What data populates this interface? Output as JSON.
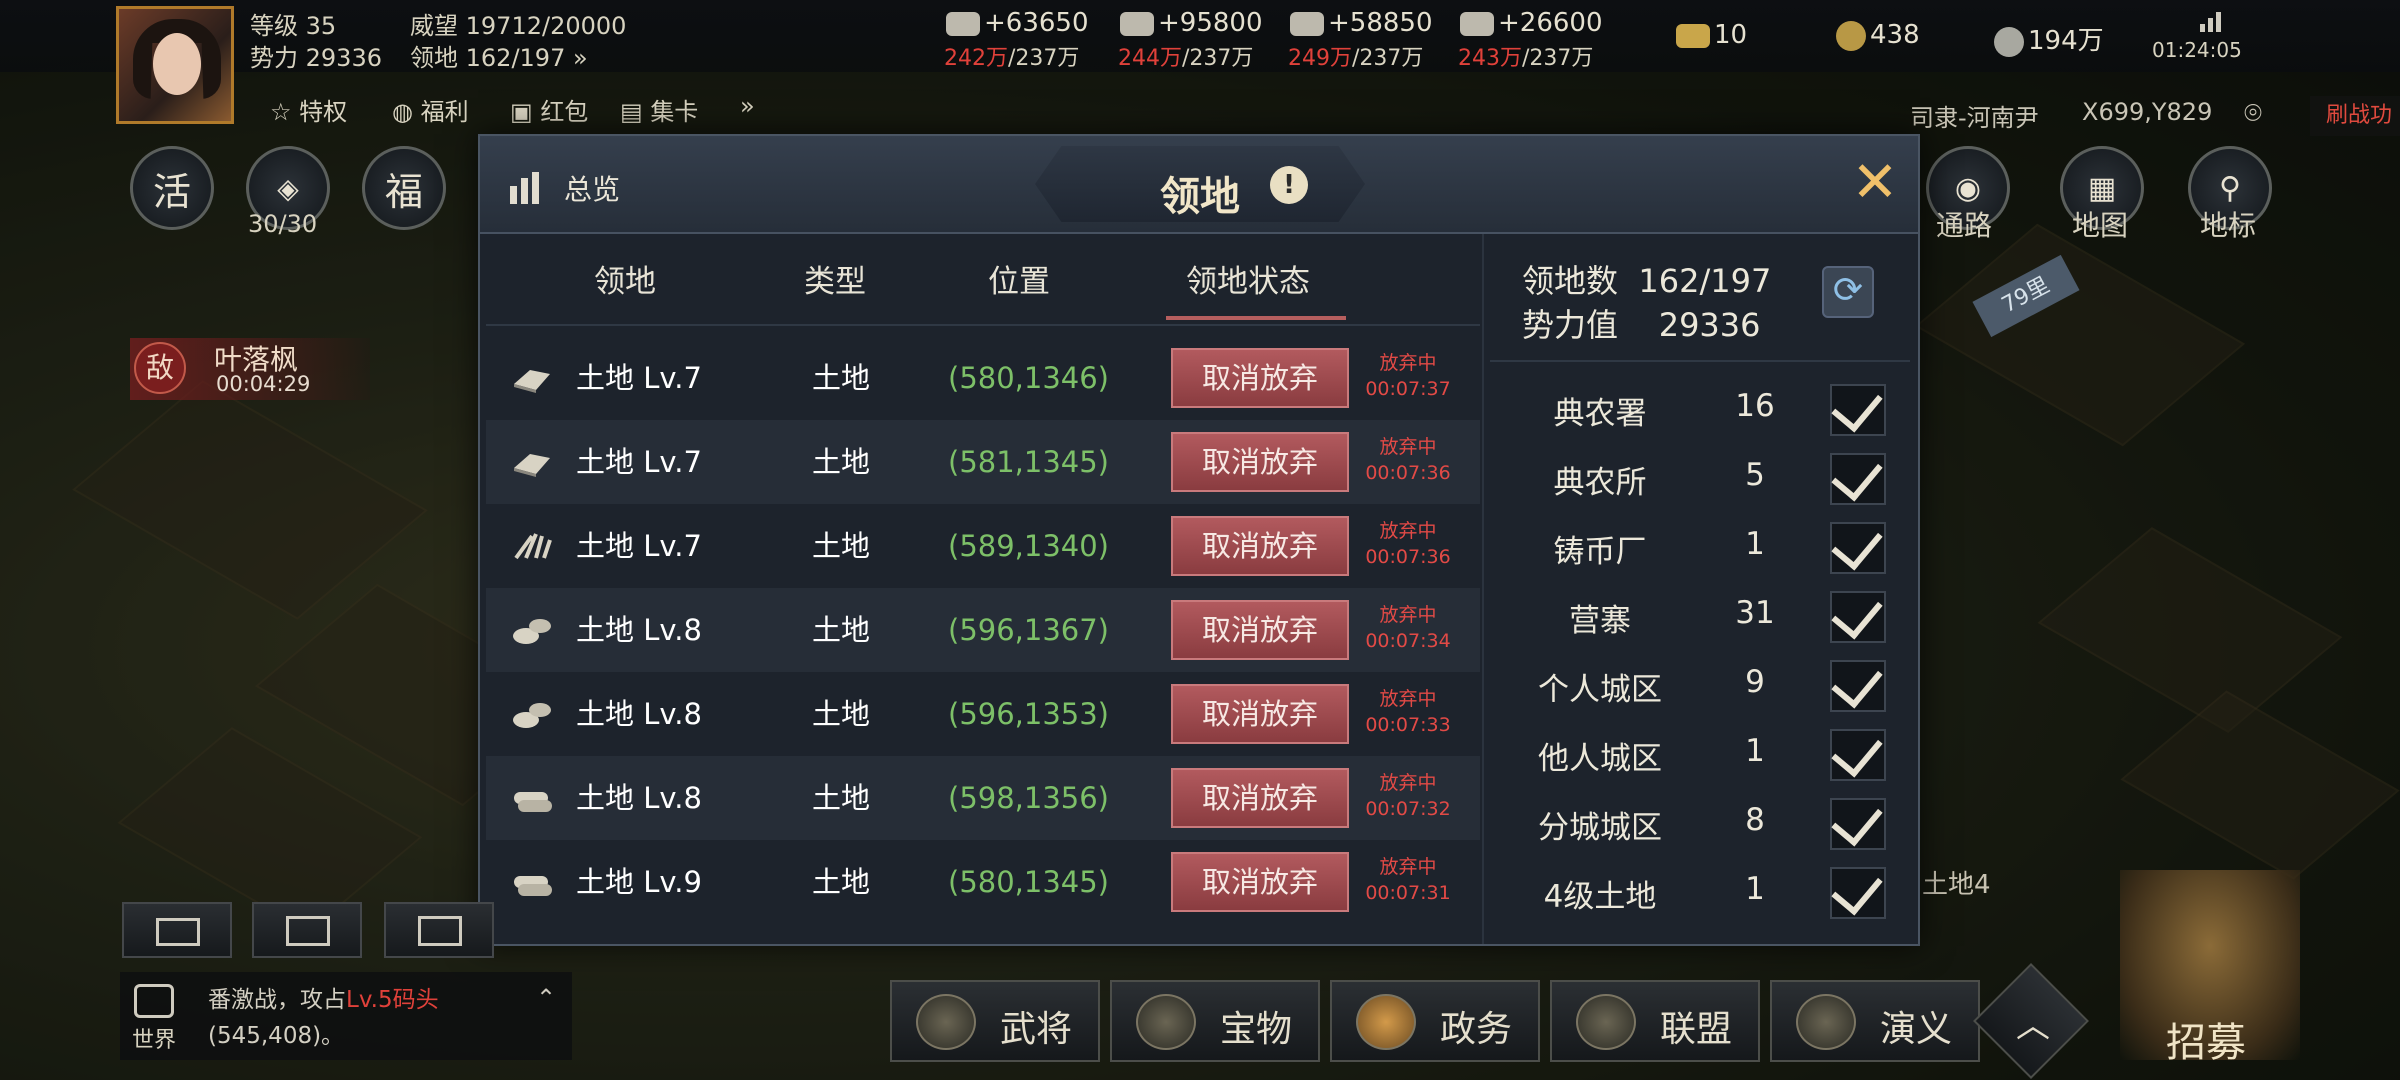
{
  "player": {
    "level_label": "等级",
    "level": "35",
    "prestige_label": "威望",
    "prestige": "19712/20000",
    "power_label": "势力",
    "power": "29336",
    "territory_label": "领地",
    "territory": "162/197"
  },
  "resources": [
    {
      "icon": "wood-icon",
      "rate": "+63650",
      "stock": "242万",
      "cap": "/237万"
    },
    {
      "icon": "stone-icon",
      "rate": "+95800",
      "stock": "244万",
      "cap": "/237万"
    },
    {
      "icon": "iron-icon",
      "rate": "+58850",
      "stock": "249万",
      "cap": "/237万"
    },
    {
      "icon": "grain-icon",
      "rate": "+26600",
      "stock": "243万",
      "cap": "/237万"
    }
  ],
  "currencies": {
    "gold_bar": "10",
    "jade": "438",
    "copper": "194万"
  },
  "clock": "01:24:05",
  "quick_menu": [
    "特权",
    "福利",
    "红包",
    "集卡"
  ],
  "side_buttons": [
    {
      "char": "活"
    },
    {
      "char": "",
      "sub": "30/30"
    },
    {
      "char": "福"
    }
  ],
  "enemy_tag": {
    "badge": "敌",
    "name": "叶落枫",
    "time": "00:04:29"
  },
  "location": {
    "region": "司隶-河南尹",
    "coords": "X699,Y829",
    "action": "刷战功"
  },
  "map_buttons": [
    "通路",
    "地图",
    "地标"
  ],
  "distance": "79里",
  "map_label": "土地4",
  "panel": {
    "overview": "总览",
    "title": "领地",
    "info": "!",
    "columns": [
      "领地",
      "类型",
      "位置",
      "领地状态"
    ],
    "rows": [
      {
        "name": "土地 Lv.7",
        "type": "土地",
        "pos": "(580,1346)",
        "action": "取消放弃",
        "status": "放弃中",
        "timer": "00:07:37",
        "icon": "iron-icon"
      },
      {
        "name": "土地 Lv.7",
        "type": "土地",
        "pos": "(581,1345)",
        "action": "取消放弃",
        "status": "放弃中",
        "timer": "00:07:36",
        "icon": "iron-icon"
      },
      {
        "name": "土地 Lv.7",
        "type": "土地",
        "pos": "(589,1340)",
        "action": "取消放弃",
        "status": "放弃中",
        "timer": "00:07:36",
        "icon": "grain-icon"
      },
      {
        "name": "土地 Lv.8",
        "type": "土地",
        "pos": "(596,1367)",
        "action": "取消放弃",
        "status": "放弃中",
        "timer": "00:07:34",
        "icon": "stone-icon"
      },
      {
        "name": "土地 Lv.8",
        "type": "土地",
        "pos": "(596,1353)",
        "action": "取消放弃",
        "status": "放弃中",
        "timer": "00:07:33",
        "icon": "stone-icon"
      },
      {
        "name": "土地 Lv.8",
        "type": "土地",
        "pos": "(598,1356)",
        "action": "取消放弃",
        "status": "放弃中",
        "timer": "00:07:32",
        "icon": "wood-icon"
      },
      {
        "name": "土地 Lv.9",
        "type": "土地",
        "pos": "(580,1345)",
        "action": "取消放弃",
        "status": "放弃中",
        "timer": "00:07:31",
        "icon": "wood-icon"
      }
    ],
    "summary": {
      "count_label": "领地数",
      "count": "162/197",
      "power_label": "势力值",
      "power": "29336"
    },
    "filters": [
      {
        "name": "典农署",
        "count": "16",
        "checked": true
      },
      {
        "name": "典农所",
        "count": "5",
        "checked": true
      },
      {
        "name": "铸币厂",
        "count": "1",
        "checked": true
      },
      {
        "name": "营寨",
        "count": "31",
        "checked": true
      },
      {
        "name": "个人城区",
        "count": "9",
        "checked": true
      },
      {
        "name": "他人城区",
        "count": "1",
        "checked": true
      },
      {
        "name": "分城城区",
        "count": "8",
        "checked": true
      },
      {
        "name": "4级土地",
        "count": "1",
        "checked": true
      }
    ]
  },
  "chat": {
    "channel": "世界",
    "prefix": "番激战，攻占",
    "highlight": "Lv.5码头",
    "suffix": "(545,408)。"
  },
  "bottom_nav": [
    "武将",
    "宝物",
    "政务",
    "联盟",
    "演义"
  ],
  "recruit": "招募",
  "colors": {
    "accent_red": "#e0413a",
    "coord_green": "#7dc068",
    "cancel_button": "#9e4a4e",
    "panel_bg": "#1d232c"
  }
}
